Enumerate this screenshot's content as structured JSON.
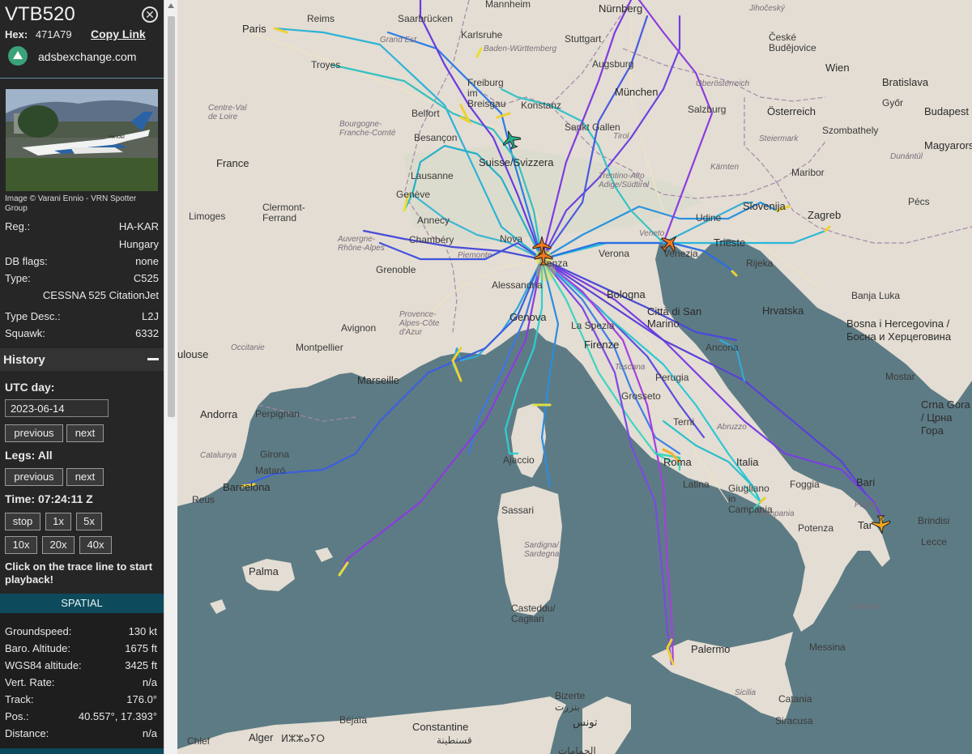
{
  "aircraft": {
    "callsign": "VTB520",
    "hex_label": "Hex:",
    "hex": "471A79",
    "copy_link": "Copy Link",
    "source": "adsbexchange.com",
    "photo_credit": "Image © Varani Ennio - VRN Spotter Group",
    "photo_tail_text": "HA-KAR",
    "details": [
      {
        "k": "Reg.:",
        "v": "HA-KAR"
      },
      {
        "k": "",
        "v": "Hungary"
      },
      {
        "k": "DB flags:",
        "v": "none"
      },
      {
        "k": "Type:",
        "v": "C525"
      },
      {
        "k": "",
        "v": "CESSNA 525 CitationJet"
      },
      {
        "k": "Type Desc.:",
        "v": "L2J"
      },
      {
        "k": "Squawk:",
        "v": "6332"
      }
    ]
  },
  "history": {
    "title": "History",
    "utc_day_label": "UTC day:",
    "utc_day": "2023-06-14",
    "previous": "previous",
    "next": "next",
    "legs_label": "Legs: All",
    "time_label": "Time: 07:24:11 Z",
    "speed_buttons": [
      "stop",
      "1x",
      "5x",
      "10x",
      "20x",
      "40x"
    ],
    "note": "Click on the trace line to start playback!"
  },
  "spatial": {
    "title": "SPATIAL",
    "rows": [
      {
        "k": "Groundspeed:",
        "v": "130 kt"
      },
      {
        "k": "Baro. Altitude:",
        "v": "1675 ft"
      },
      {
        "k": "WGS84 altitude:",
        "v": "3425 ft"
      },
      {
        "k": "Vert. Rate:",
        "v": "n/a"
      },
      {
        "k": "Track:",
        "v": "176.0°"
      },
      {
        "k": "Pos.:",
        "v": "40.557°, 17.393°"
      },
      {
        "k": "Distance:",
        "v": "n/a"
      }
    ]
  },
  "map": {
    "labels": {
      "paris": "Paris",
      "reims": "Reims",
      "troyes": "Troyes",
      "grand_est": "Grand Est",
      "saarbrucken": "Saarbrücken",
      "mannheim": "Mannheim",
      "nurnberg": "Nürnberg",
      "karlsruhe": "Karlsruhe",
      "stuttgart": "Stuttgart",
      "bw": "Baden-Württemberg",
      "augsburg": "Augsburg",
      "munchen": "München",
      "freiburg": "Freiburg im Breisgau",
      "konstanz": "Konstanz",
      "sanktgallen": "Sankt Gallen",
      "belfort": "Belfort",
      "besancon": "Besançon",
      "bourgogne": "Bourgogne-Franche-Comté",
      "centre": "Centre-Val de Loire",
      "france": "France",
      "lausanne": "Lausanne",
      "geneve": "Genève",
      "suisse": "Suisse/Svizzera",
      "annecy": "Annecy",
      "chambery": "Chambéry",
      "grenoble": "Grenoble",
      "clermont": "Clermont-Ferrand",
      "limoges": "Limoges",
      "auvergne": "Auvergne-Rhône-Alpes",
      "avignon": "Avignon",
      "montpellier": "Montpellier",
      "toulouse": "ulouse",
      "occitanie": "Occitanie",
      "marseille": "Marseille",
      "provence": "Provence-Alpes-Côte d'Azur",
      "andorra": "Andorra",
      "perpignan": "Perpignan",
      "girona": "Girona",
      "catalunya": "Catalunya",
      "mataro": "Mataró",
      "barcelona": "Barcelona",
      "reus": "Reus",
      "palma": "Palma",
      "ceske": "České Budějovice",
      "jihocesky": "Jihočeský",
      "wien": "Wien",
      "bratislava": "Bratislava",
      "gyor": "Győr",
      "budapest": "Budapest",
      "magyarorszag": "Magyarorszá",
      "osterreich": "Österreich",
      "oberosterreich": "Oberösterreich",
      "salzburg": "Salzburg",
      "steiermark": "Steiermark",
      "kaernten": "Kärnten",
      "szombathely": "Szombathely",
      "maribor": "Maribor",
      "slovenija": "Slovenija",
      "zagreb": "Zagreb",
      "pecs": "Pécs",
      "dunantul": "Dunántúl",
      "udine": "Udine",
      "trieste": "Trieste",
      "rijeka": "Rijeka",
      "venezia": "Venezia",
      "veneto": "Veneto",
      "tirol": "Tirol",
      "trentino": "Trentino-Alto Adige/Südtirol",
      "verona": "Verona",
      "novara": "Nova",
      "milano": "enza",
      "piemonte": "Piemonte",
      "alessandria": "Alessandria",
      "genova": "Genova",
      "laspezia": "La Spezia",
      "bologna": "Bologna",
      "firenze": "Firenze",
      "toscana": "Toscana",
      "sanmarino": "Città di San Marino",
      "ancona": "Ancona",
      "perugia": "Perugia",
      "grosseto": "Grosseto",
      "terni": "Terni",
      "abruzzo": "Abruzzo",
      "roma": "Roma",
      "latina": "Latina",
      "italia": "Italia",
      "foggia": "Foggia",
      "bari": "Bari",
      "taranto": "Tar",
      "brindisi": "Brindisi",
      "lecce": "Lecce",
      "puglia": "Puglia",
      "potenza": "Potenza",
      "campania": "Campania",
      "napoli": "Giugliano in Campania",
      "calabria": "Calabria",
      "messina": "Messina",
      "palermo": "Palermo",
      "sicilia": "Sicilia",
      "catania": "Catania",
      "siracusa": "Siracusa",
      "ajaccio": "Ajaccio",
      "sassari": "Sassari",
      "sardegna": "Sardigna/ Sardegna",
      "cagliari": "Casteddu/ Cagliari",
      "hrvatska": "Hrvatska",
      "banjaluka": "Banja Luka",
      "bosna": "Bosna i Hercegovina / Босна и Херцеговина",
      "mostar": "Mostar",
      "crnagora": "Crna Gora / Црна Гора",
      "bizerte": "Bizerte",
      "tunis": "تونس",
      "bejaia": "Béjaïa",
      "constantine": "Constantine",
      "constantine_ar": "قسنطينة",
      "hammamet": "الحمامات",
      "chlef": "Chlef",
      "alger": "Alger",
      "alger_ar": "ⵍⵣⵣⴰⵢⵔ",
      "bizerte_ar": "بنزرت"
    }
  }
}
